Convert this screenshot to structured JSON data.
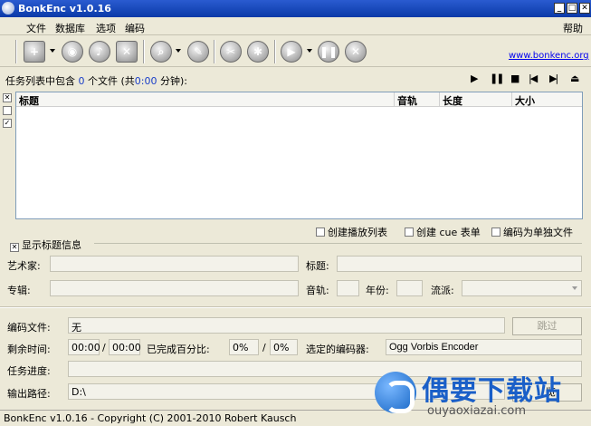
{
  "window": {
    "title": "BonkEnc v1.0.16"
  },
  "menu": {
    "items": [
      "文件",
      "数据库",
      "选项",
      "编码"
    ],
    "help": "帮助"
  },
  "toolbar": {
    "website_link": "www.bonkenc.org"
  },
  "job": {
    "summary_prefix": "任务列表中包含 ",
    "file_count": "0",
    "summary_mid": " 个文件 (共",
    "total_time": "0:00",
    "summary_suffix": " 分钟):"
  },
  "player_controls": {
    "play": "▶",
    "pause": "❚❚",
    "stop": "■",
    "prev": "|◀",
    "next": "▶|",
    "eject": "⏏"
  },
  "tracklist": {
    "columns": [
      "标题",
      "音轨",
      "长度",
      "大小"
    ],
    "side_marks": [
      "✕",
      "",
      "✓"
    ]
  },
  "options": {
    "create_playlist": "创建播放列表",
    "create_cue": "创建 cue 表单",
    "encode_single": "编码为单独文件"
  },
  "tag_info": {
    "toggle_label": "显示标题信息",
    "artist_label": "艺术家:",
    "title_label": "标题:",
    "album_label": "专辑:",
    "track_label": "音轨:",
    "year_label": "年份:",
    "genre_label": "流派:"
  },
  "encoding": {
    "file_label": "编码文件:",
    "file_value": "无",
    "skip_button": "跳过",
    "remaining_label": "剩余时间:",
    "remaining_1": "00:00",
    "remaining_sep": "/",
    "remaining_2": "00:00",
    "percent_label": "已完成百分比:",
    "percent_1": "0%",
    "percent_sep": "/",
    "percent_2": "0%",
    "encoder_label": "选定的编码器:",
    "encoder_value": "Ogg Vorbis Encoder",
    "progress_label": "任务进度:",
    "progress": 0,
    "output_label": "输出路径:",
    "output_value": "D:\\",
    "browse_partial": "览"
  },
  "statusbar": {
    "text": "BonkEnc v1.0.16 - Copyright (C) 2001-2010 Robert Kausch"
  },
  "watermark": {
    "brand": "偶要下载站",
    "url": "ouyaoxiazai.com"
  }
}
